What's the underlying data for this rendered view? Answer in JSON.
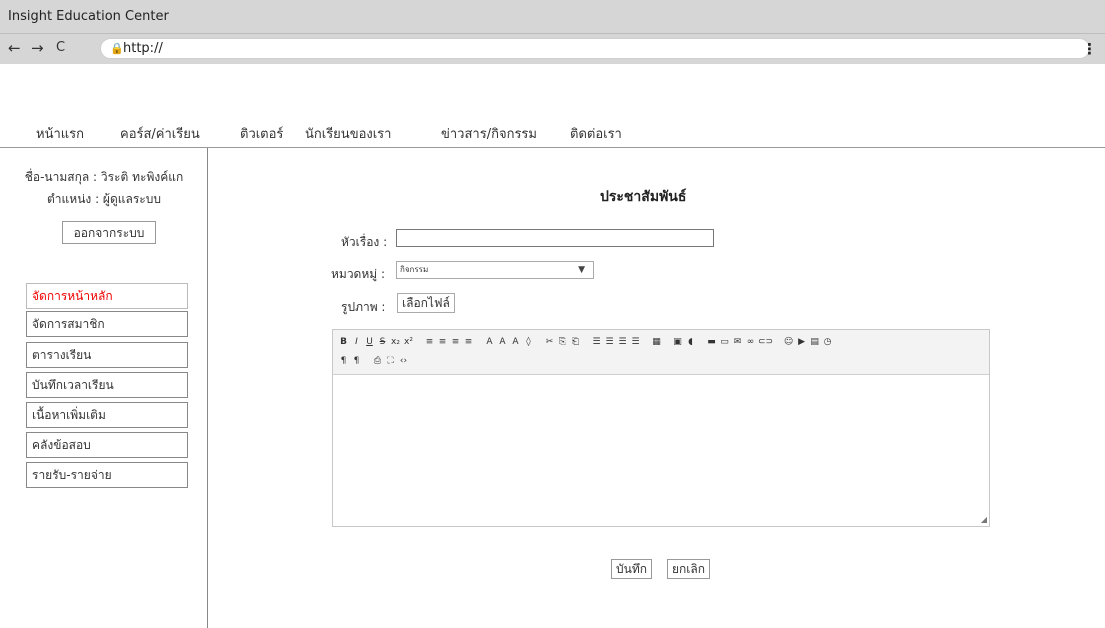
{
  "browser": {
    "window_title": "Insight Education Center",
    "url": "http://",
    "back_icon": "←",
    "forward_icon": "→",
    "reload_icon": "C",
    "lock_icon": "🔒",
    "menu_icon": "⋮"
  },
  "topnav": {
    "items": [
      "หน้าแรก",
      "คอร์ส/ค่าเรียน",
      "ติวเตอร์",
      "นักเรียนของเรา",
      "ข่าวสาร/กิจกรรม",
      "ติดต่อเรา"
    ]
  },
  "sidebar": {
    "name_line": "ชื่อ-นามสกุล : วิระติ ทะพิงค์แก",
    "position_line": "ตำแหน่ง : ผู้ดูแลระบบ",
    "logout_label": "ออกจากระบบ",
    "menu": [
      "จัดการหน้าหลัก",
      "จัดการสมาชิก",
      "ตารางเรียน",
      "บันทึกเวลาเรียน",
      "เนื้อหาเพิ่มเติม",
      "คลังข้อสอบ",
      "รายรับ-รายจ่าย"
    ],
    "active_index": 0,
    "active_color": "#e00000"
  },
  "form": {
    "title": "ประชาสัมพันธ์",
    "subject_label": "หัวเรื่อง :",
    "subject_value": "",
    "category_label": "หมวดหมู่ :",
    "category_value": "กิจกรรม",
    "image_label": "รูปภาพ :",
    "file_button": "เลือกไฟล์",
    "save_button": "บันทึก",
    "cancel_button": "ยกเลิก"
  },
  "editor": {
    "toolbar_row1": [
      "B",
      "I",
      "U",
      "S",
      "x₂",
      "x²",
      "|",
      "≡",
      "≡",
      "≡",
      "≡",
      "|",
      "A",
      "A",
      "A",
      "◊",
      "|",
      "✂",
      "⎘",
      "⎗",
      "|",
      "☰",
      "☰",
      "☰",
      "☰",
      "|",
      "▦",
      "|",
      "▣",
      "◖",
      "|",
      "▬",
      "▭",
      "✉",
      "∞",
      "⊂⊃",
      "|",
      "☺",
      "▶",
      "▤",
      "◷"
    ],
    "toolbar_row2": [
      "¶",
      "¶",
      "|",
      "⎙",
      "⛶",
      "‹›"
    ]
  }
}
